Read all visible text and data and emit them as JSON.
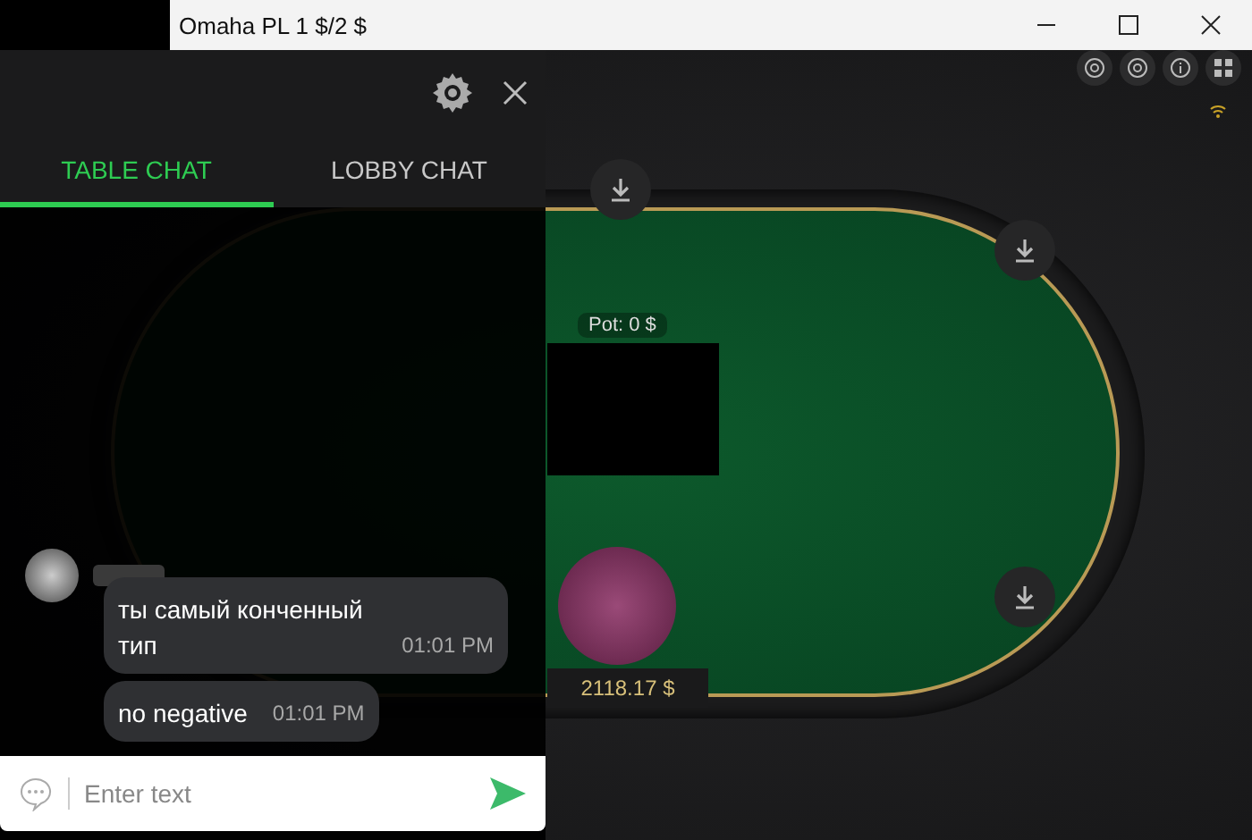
{
  "window": {
    "title": "Omaha PL 1 $/2 $"
  },
  "chat": {
    "tabs": [
      {
        "label": "TABLE CHAT",
        "selected": true
      },
      {
        "label": "LOBBY CHAT",
        "selected": false
      }
    ],
    "messages": [
      {
        "text": "ты самый конченный тип",
        "time": "01:01 PM",
        "show_sender": true
      },
      {
        "text": "no negative",
        "time": "01:01 PM",
        "show_sender": false
      }
    ],
    "input": {
      "placeholder": "Enter text"
    }
  },
  "table": {
    "pot": "Pot: 0 $",
    "player_stack": "2118.17 $"
  }
}
